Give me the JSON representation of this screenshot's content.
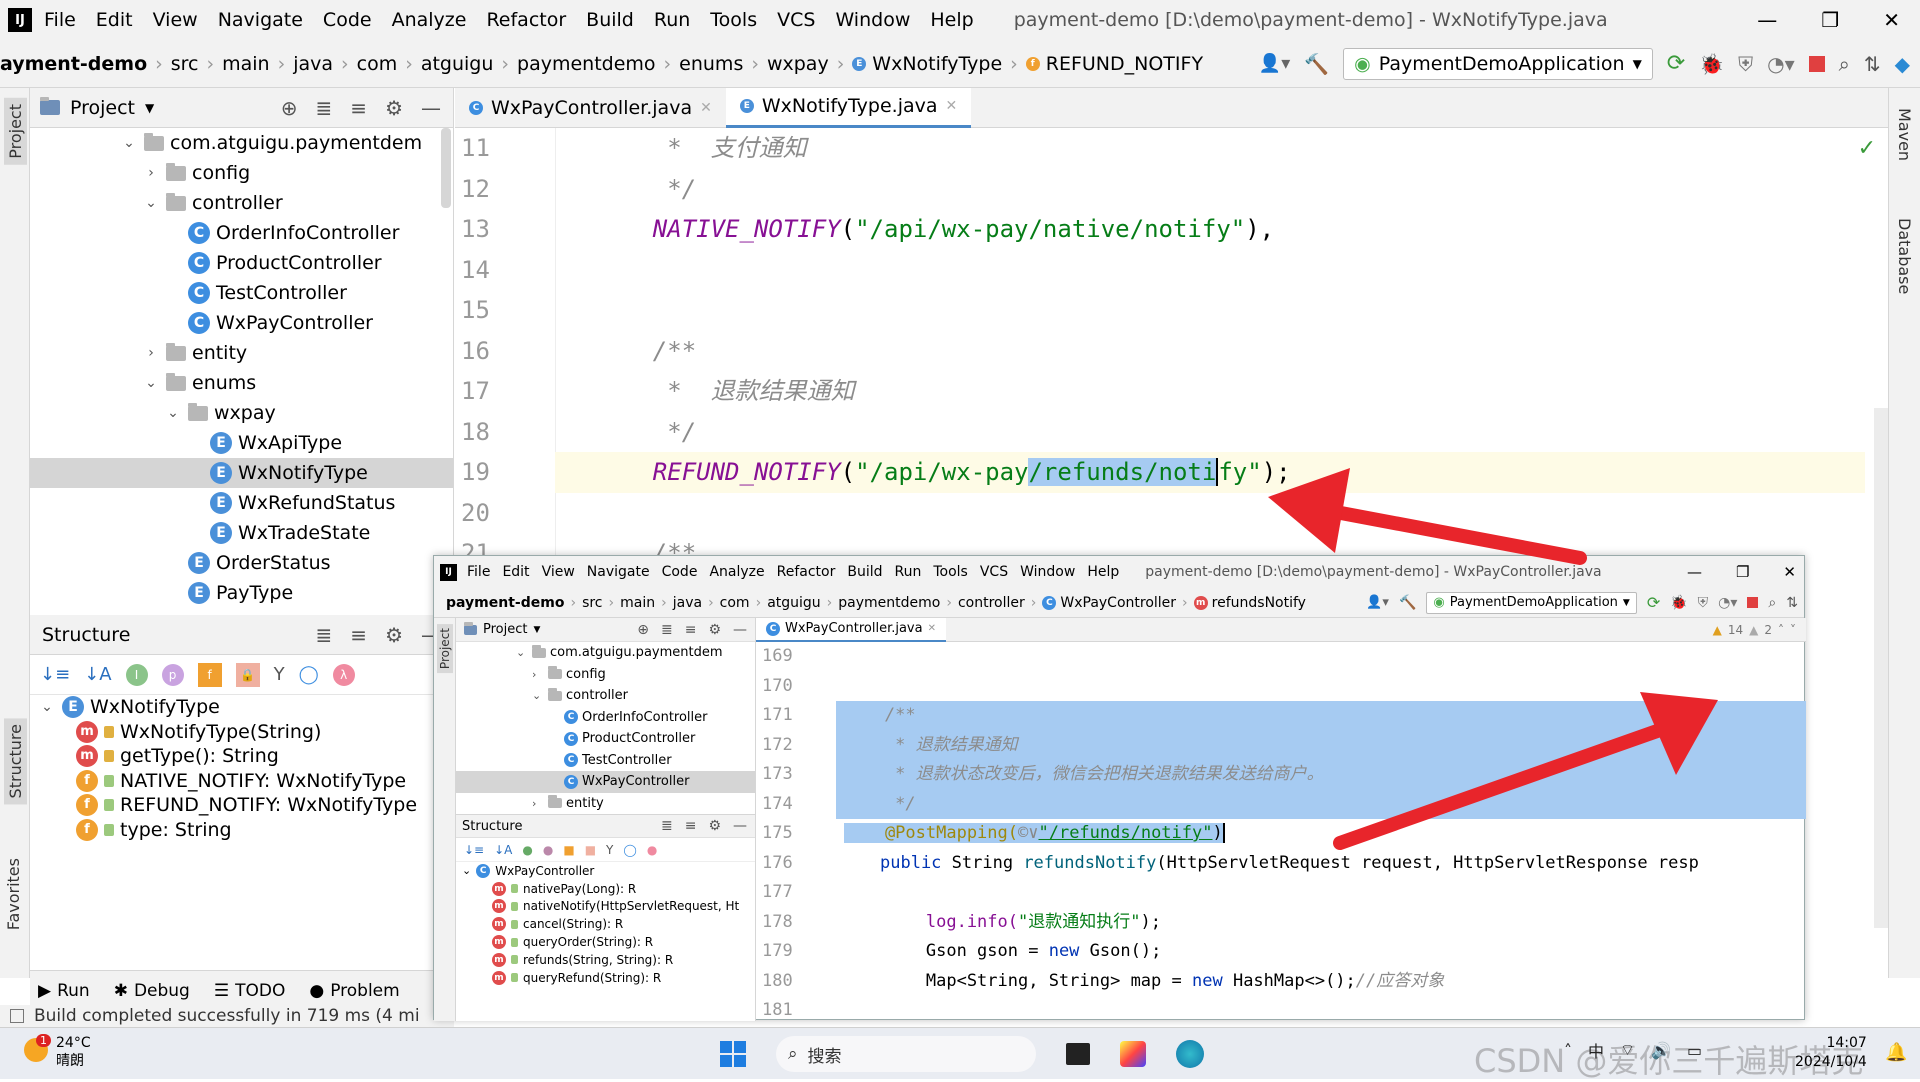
{
  "titlebar": {
    "menu": [
      "File",
      "Edit",
      "View",
      "Navigate",
      "Code",
      "Analyze",
      "Refactor",
      "Build",
      "Run",
      "Tools",
      "VCS",
      "Window",
      "Help"
    ],
    "title": "payment-demo [D:\\demo\\payment-demo] - WxNotifyType.java"
  },
  "navbar": {
    "crumbs": [
      "ayment-demo",
      "src",
      "main",
      "java",
      "com",
      "atguigu",
      "paymentdemo",
      "enums",
      "wxpay",
      "WxNotifyType",
      "REFUND_NOTIFY"
    ],
    "run_config": "PaymentDemoApplication"
  },
  "project": {
    "header": "Project",
    "tree": [
      {
        "label": "com.atguigu.paymentdem",
        "indent": 0,
        "kind": "folder",
        "arrow": "v"
      },
      {
        "label": "config",
        "indent": 1,
        "kind": "folder",
        "arrow": ">"
      },
      {
        "label": "controller",
        "indent": 1,
        "kind": "folder",
        "arrow": "v"
      },
      {
        "label": "OrderInfoController",
        "indent": 2,
        "kind": "class",
        "arrow": ""
      },
      {
        "label": "ProductController",
        "indent": 2,
        "kind": "class",
        "arrow": ""
      },
      {
        "label": "TestController",
        "indent": 2,
        "kind": "class",
        "arrow": ""
      },
      {
        "label": "WxPayController",
        "indent": 2,
        "kind": "class",
        "arrow": ""
      },
      {
        "label": "entity",
        "indent": 1,
        "kind": "folder",
        "arrow": ">"
      },
      {
        "label": "enums",
        "indent": 1,
        "kind": "folder",
        "arrow": "v"
      },
      {
        "label": "wxpay",
        "indent": 2,
        "kind": "folder",
        "arrow": "v"
      },
      {
        "label": "WxApiType",
        "indent": 3,
        "kind": "enum",
        "arrow": ""
      },
      {
        "label": "WxNotifyType",
        "indent": 3,
        "kind": "enum",
        "arrow": "",
        "selected": true
      },
      {
        "label": "WxRefundStatus",
        "indent": 3,
        "kind": "enum",
        "arrow": ""
      },
      {
        "label": "WxTradeState",
        "indent": 3,
        "kind": "enum",
        "arrow": ""
      },
      {
        "label": "OrderStatus",
        "indent": 2,
        "kind": "enum",
        "arrow": ""
      },
      {
        "label": "PayType",
        "indent": 2,
        "kind": "enum",
        "arrow": ""
      }
    ]
  },
  "structure": {
    "header": "Structure",
    "items": [
      {
        "label": "WxNotifyType",
        "kind": "enum",
        "root": true
      },
      {
        "label": "WxNotifyType(String)",
        "kind": "method"
      },
      {
        "label": "getType(): String",
        "kind": "method"
      },
      {
        "label": "NATIVE_NOTIFY: WxNotifyType",
        "kind": "field"
      },
      {
        "label": "REFUND_NOTIFY: WxNotifyType",
        "kind": "field"
      },
      {
        "label": "type: String",
        "kind": "field"
      }
    ]
  },
  "bottom": {
    "tabs": [
      "Run",
      "Debug",
      "TODO",
      "Problem"
    ],
    "status": "Build completed successfully in 719 ms (4 mi"
  },
  "side_labels": {
    "left": [
      "Project",
      "Structure",
      "Favorites"
    ],
    "right": [
      "Maven",
      "Database"
    ]
  },
  "editor": {
    "tabs": [
      {
        "label": "WxPayController.java",
        "kind": "class"
      },
      {
        "label": "WxNotifyType.java",
        "kind": "enum",
        "active": true
      }
    ],
    "lines": [
      {
        "n": "11",
        "text": "     *  支付通知",
        "style": "cmt"
      },
      {
        "n": "12",
        "text": "     */",
        "style": "cmt"
      },
      {
        "n": "13",
        "pre": "    ",
        "enum": "NATIVE_NOTIFY",
        "open": "(",
        "str": "\"/api/wx-pay/native/notify\"",
        "close": "),"
      },
      {
        "n": "14",
        "text": ""
      },
      {
        "n": "15",
        "text": ""
      },
      {
        "n": "16",
        "text": "    /**",
        "style": "cmt"
      },
      {
        "n": "17",
        "text": "     *  退款结果通知",
        "style": "cmt"
      },
      {
        "n": "18",
        "text": "     */",
        "style": "cmt"
      },
      {
        "n": "19",
        "pre": "    ",
        "enum": "REFUND_NOTIFY",
        "open": "(",
        "str_a": "\"/api/wx-pay",
        "str_sel": "/refunds/noti",
        "str_b": "fy\"",
        "close": ");"
      },
      {
        "n": "20",
        "text": ""
      },
      {
        "n": "21",
        "text": "    /**",
        "style": "cmt"
      }
    ]
  },
  "overlay": {
    "menu": [
      "File",
      "Edit",
      "View",
      "Navigate",
      "Code",
      "Analyze",
      "Refactor",
      "Build",
      "Run",
      "Tools",
      "VCS",
      "Window",
      "Help"
    ],
    "title": "payment-demo [D:\\demo\\payment-demo] - WxPayController.java",
    "crumbs": [
      "payment-demo",
      "src",
      "main",
      "java",
      "com",
      "atguigu",
      "paymentdemo",
      "controller",
      "WxPayController",
      "refundsNotify"
    ],
    "run_config": "PaymentDemoApplication",
    "project_header": "Project",
    "tree": [
      {
        "label": "com.atguigu.paymentdem",
        "indent": 0,
        "kind": "folder",
        "arrow": "v"
      },
      {
        "label": "config",
        "indent": 1,
        "kind": "folder",
        "arrow": ">"
      },
      {
        "label": "controller",
        "indent": 1,
        "kind": "folder",
        "arrow": "v"
      },
      {
        "label": "OrderInfoController",
        "indent": 2,
        "kind": "class",
        "arrow": ""
      },
      {
        "label": "ProductController",
        "indent": 2,
        "kind": "class",
        "arrow": ""
      },
      {
        "label": "TestController",
        "indent": 2,
        "kind": "class",
        "arrow": ""
      },
      {
        "label": "WxPayController",
        "indent": 2,
        "kind": "class",
        "arrow": "",
        "selected": true
      },
      {
        "label": "entity",
        "indent": 1,
        "kind": "folder",
        "arrow": ">"
      }
    ],
    "structure_header": "Structure",
    "structure": [
      {
        "label": "WxPayController",
        "kind": "class",
        "root": true
      },
      {
        "label": "nativePay(Long): R",
        "kind": "method"
      },
      {
        "label": "nativeNotify(HttpServletRequest, Ht",
        "kind": "method"
      },
      {
        "label": "cancel(String): R",
        "kind": "method"
      },
      {
        "label": "queryOrder(String): R",
        "kind": "method"
      },
      {
        "label": "refunds(String, String): R",
        "kind": "method"
      },
      {
        "label": "queryRefund(String): R",
        "kind": "method"
      }
    ],
    "tab": "WxPayController.java",
    "warnings": "14",
    "weak_warnings": "2",
    "lines": [
      {
        "n": "169",
        "text": ""
      },
      {
        "n": "170",
        "text": ""
      },
      {
        "n": "171",
        "text": "    /**",
        "style": "cmt",
        "sel": true
      },
      {
        "n": "172",
        "text": "     * 退款结果通知",
        "style": "cmt",
        "sel": true
      },
      {
        "n": "173",
        "text": "     * 退款状态改变后，微信会把相关退款结果发送给商户。",
        "style": "cmt",
        "sel": true
      },
      {
        "n": "174",
        "text": "     */",
        "style": "cmt",
        "sel": true
      },
      {
        "n": "175",
        "ann": "    @PostMapping(",
        "mid": "©∨",
        "str": "\"/refunds/notify\"",
        "close": ")"
      },
      {
        "n": "176",
        "kw": "public ",
        "t1": "String ",
        "fn": "refundsNotify",
        "rest": "(HttpServletRequest request, HttpServletResponse resp"
      },
      {
        "n": "177",
        "text": ""
      },
      {
        "n": "178",
        "log": "        log.info(",
        "str": "\"退款通知执行\"",
        "close": ");"
      },
      {
        "n": "179",
        "plain": "        Gson gson = ",
        "kw": "new ",
        "rest": "Gson();"
      },
      {
        "n": "180",
        "plain": "        Map<String, String> map = ",
        "kw": "new ",
        "rest": "HashMap<>();",
        "c": "//应答对象"
      },
      {
        "n": "181",
        "text": ""
      }
    ]
  },
  "taskbar": {
    "temp": "24°C",
    "weather": "晴朗",
    "badge": "1",
    "search": "搜索",
    "time": "14:07",
    "date": "2024/10/4",
    "ime": "中"
  },
  "watermark": "CSDN @爱你三千遍斯塔克",
  "colors": {
    "arrow": "#e8252b",
    "selection": "#a6cbf2",
    "accent": "#3d8ee0"
  }
}
